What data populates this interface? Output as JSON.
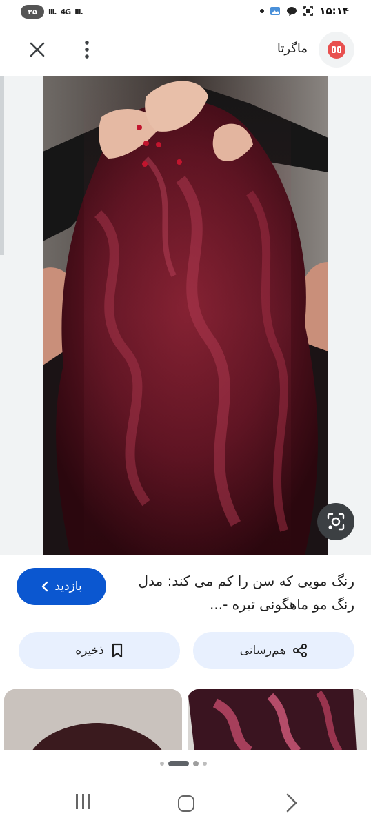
{
  "status_bar": {
    "time": "۱۵:۱۴",
    "battery": "۲۵",
    "signal_1": "lll.",
    "network": "4G",
    "signal_2": "lll."
  },
  "header": {
    "site_name": "ماگرتا",
    "close_icon": "close-icon",
    "more_icon": "more-vert-icon"
  },
  "result": {
    "title": "رنگ مویی که سن را کم می کند: مدل رنگ مو ماهگونی تیره -...",
    "visit_label": "بازدید"
  },
  "actions": {
    "share_label": "هم‌رسانی",
    "save_label": "ذخیره"
  },
  "colors": {
    "accent": "#0b57d0",
    "chip_bg": "#e8f0fe",
    "logo_red": "#e8504f"
  }
}
